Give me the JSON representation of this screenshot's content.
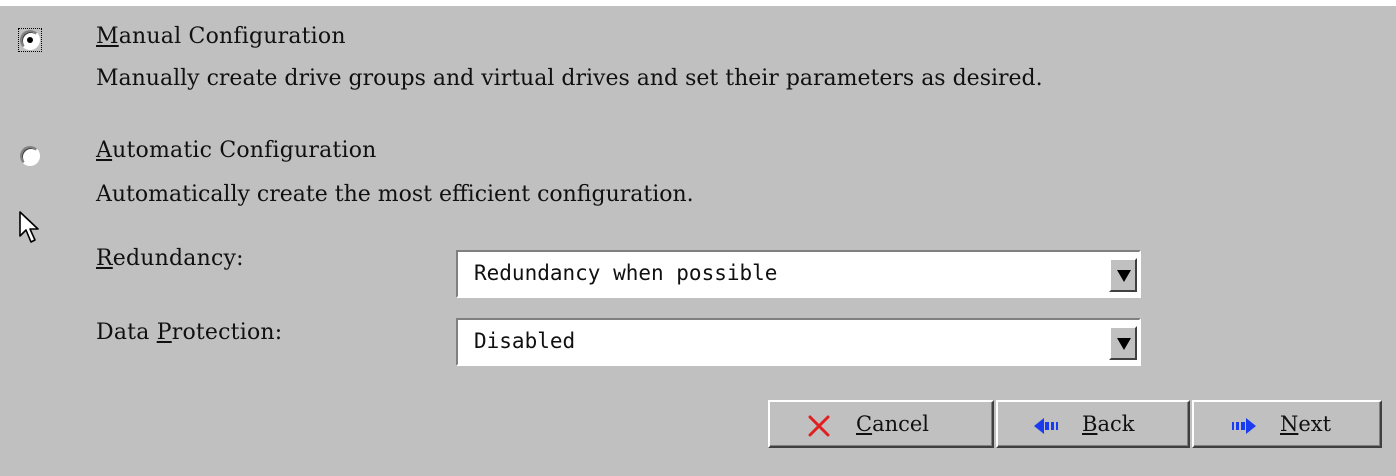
{
  "manual": {
    "label_mnemonic": "M",
    "label_rest": "anual Configuration",
    "description": "Manually create drive groups and virtual drives and set their parameters as desired.",
    "selected": true
  },
  "automatic": {
    "label_mnemonic": "A",
    "label_rest": "utomatic Configuration",
    "description": "Automatically create the most efficient configuration.",
    "selected": false
  },
  "redundancy": {
    "label_mnemonic": "R",
    "label_rest": "edundancy:",
    "value": "Redundancy when possible"
  },
  "data_protection": {
    "label_prefix": "Data ",
    "label_mnemonic": "P",
    "label_rest": "rotection:",
    "value": "Disabled"
  },
  "buttons": {
    "cancel": {
      "mnemonic": "C",
      "rest": "ancel",
      "icon": "x-icon",
      "icon_color": "#e02020"
    },
    "back": {
      "mnemonic": "B",
      "rest": "ack",
      "icon": "arrow-left-icon",
      "icon_color": "#1a3cf0"
    },
    "next": {
      "mnemonic": "N",
      "rest": "ext",
      "icon": "arrow-right-icon",
      "icon_color": "#1a3cf0"
    }
  },
  "colors": {
    "background": "#c0c0c0",
    "field": "#ffffff"
  }
}
